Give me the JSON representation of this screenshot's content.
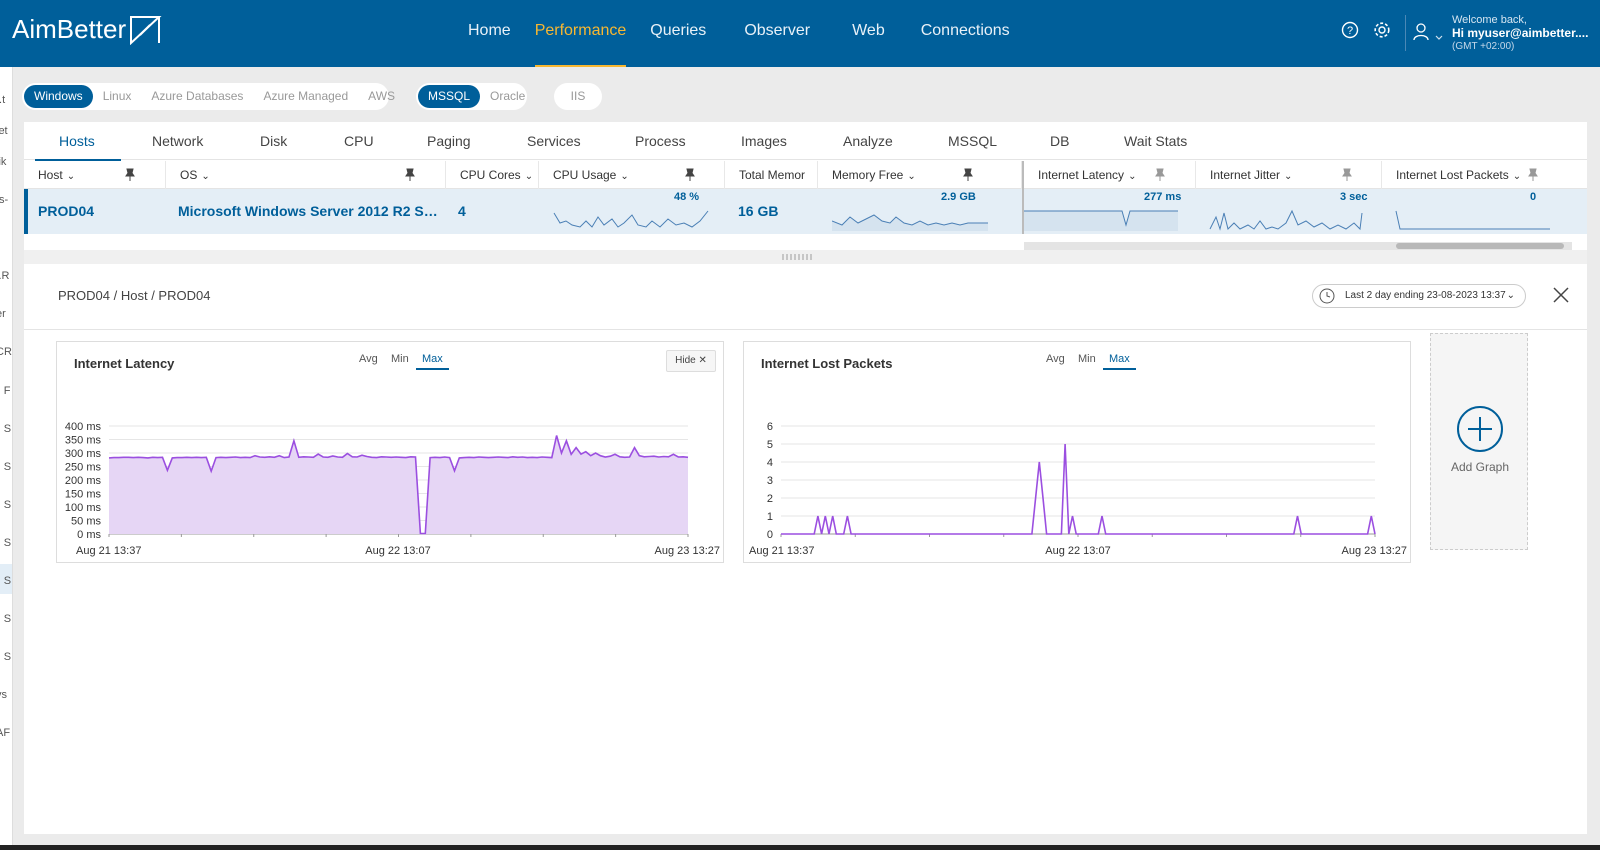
{
  "app": {
    "logo_text": "AimBetter",
    "brand_color": "#005f9a",
    "accent_color": "#f7b731"
  },
  "nav": {
    "items": [
      {
        "label": "Home"
      },
      {
        "label": "Performance",
        "active": true
      },
      {
        "label": "Queries"
      },
      {
        "label": "Observer"
      },
      {
        "label": "Web"
      },
      {
        "label": "Connections"
      }
    ]
  },
  "header": {
    "icons": [
      "help-icon",
      "settings-icon",
      "user-icon",
      "chevron-down-icon"
    ],
    "welcome": "Welcome back,",
    "user": "Hi myuser@aimbetter....",
    "timezone": "(GMT +02:00)"
  },
  "sidebar": {
    "fragments": [
      "ı.t",
      "let",
      "lik",
      "ıs-",
      "r",
      "l.R",
      "er",
      "CR",
      "▌F",
      "▌S",
      "▌S",
      "▌S",
      "▌S",
      "▌S",
      "▌S",
      "▌S",
      "ys",
      "AF"
    ]
  },
  "filters": {
    "platforms": [
      "Windows",
      "Linux",
      "Azure Databases",
      "Azure Managed",
      "AWS"
    ],
    "platform_selected": "Windows",
    "db_types": [
      "MSSQL",
      "Oracle"
    ],
    "db_selected": "MSSQL",
    "web": [
      "IIS"
    ]
  },
  "tabs": [
    "Hosts",
    "Network",
    "Disk",
    "CPU",
    "Paging",
    "Services",
    "Process",
    "Images",
    "Analyze",
    "MSSQL",
    "DB",
    "Wait Stats"
  ],
  "active_tab": "Hosts",
  "table": {
    "columns": [
      "Host",
      "OS",
      "CPU Cores",
      "CPU Usage",
      "Total Memor",
      "Memory Free",
      "Internet Latency",
      "Internet Jitter",
      "Internet Lost Packets"
    ],
    "row": {
      "host": "PROD04",
      "os": "Microsoft Windows Server 2012 R2 Standard",
      "cpu_cores": "4",
      "cpu_usage": "48 %",
      "total_memory": "16 GB",
      "memory_free": "2.9 GB",
      "internet_latency": "277 ms",
      "internet_jitter": "3 sec",
      "internet_lost_packets": "0"
    }
  },
  "detail": {
    "breadcrumb": "PROD04 / Host / PROD04",
    "time_range": "Last 2 day ending  23-08-2023 13:37",
    "add_graph_label": "Add Graph",
    "hide_label": "Hide",
    "aggregations": [
      "Avg",
      "Min",
      "Max"
    ],
    "aggregation_selected": "Max"
  },
  "chart_data": [
    {
      "type": "area",
      "title": "Internet Latency",
      "y_ticks": [
        "0 ms",
        "50 ms",
        "100 ms",
        "150 ms",
        "200 ms",
        "250 ms",
        "300 ms",
        "350 ms",
        "400 ms"
      ],
      "ylim": [
        0,
        400
      ],
      "x_labels": [
        "Aug 21 13:37",
        "Aug 22 13:07",
        "Aug 23 13:27"
      ],
      "grid": true,
      "color": "#9b4fe0",
      "fill": "#e6d6f5",
      "series": [
        {
          "values": [
            282,
            283,
            283,
            284,
            284,
            283,
            284,
            283,
            282,
            284,
            283,
            284,
            236,
            282,
            283,
            283,
            284,
            283,
            284,
            283,
            284,
            233,
            283,
            284,
            283,
            284,
            285,
            283,
            284,
            283,
            290,
            285,
            284,
            286,
            284,
            290,
            283,
            285,
            345,
            284,
            286,
            285,
            284,
            296,
            285,
            284,
            289,
            285,
            284,
            298,
            286,
            285,
            292,
            287,
            284,
            283,
            286,
            285,
            284,
            285,
            284,
            283,
            286,
            285,
            2,
            2,
            283,
            284,
            283,
            285,
            283,
            234,
            282,
            283,
            284,
            283,
            285,
            284,
            283,
            284,
            285,
            284,
            283,
            286,
            284,
            285,
            283,
            284,
            283,
            285,
            284,
            283,
            365,
            300,
            345,
            295,
            320,
            296,
            305,
            290,
            300,
            290,
            285,
            288,
            295,
            286,
            284,
            285,
            320,
            290,
            286,
            287,
            288,
            285,
            287,
            286,
            295,
            285,
            286,
            284
          ]
        }
      ]
    },
    {
      "type": "line",
      "title": "Internet Lost Packets",
      "y_ticks": [
        "0",
        "1",
        "2",
        "3",
        "4",
        "5",
        "6"
      ],
      "ylim": [
        0,
        6
      ],
      "x_labels": [
        "Aug 21 13:37",
        "Aug 22 13:07",
        "Aug 23 13:27"
      ],
      "grid": true,
      "color": "#9b4fe0",
      "series": [
        {
          "values": [
            0,
            0,
            0,
            0,
            0,
            0,
            0,
            0,
            0,
            0,
            1,
            0,
            1,
            0,
            1,
            0,
            0,
            0,
            1,
            0,
            0,
            0,
            0,
            0,
            0,
            0,
            0,
            0,
            0,
            0,
            0,
            0,
            0,
            0,
            0,
            0,
            0,
            0,
            0,
            0,
            0,
            0,
            0,
            0,
            0,
            0,
            0,
            0,
            0,
            0,
            0,
            0,
            0,
            0,
            0,
            0,
            0,
            0,
            0,
            0,
            0,
            0,
            0,
            0,
            0,
            0,
            0,
            0,
            0,
            2,
            4,
            2,
            0,
            0,
            0,
            0,
            0,
            5,
            0,
            1,
            0,
            0,
            0,
            0,
            0,
            0,
            0,
            1,
            0,
            0,
            0,
            0,
            0,
            0,
            0,
            0,
            0,
            0,
            0,
            0,
            0,
            0,
            0,
            0,
            0,
            0,
            0,
            0,
            0,
            0,
            0,
            0,
            0,
            0,
            0,
            0,
            0,
            0,
            0,
            0,
            0,
            0,
            0,
            0,
            0,
            0,
            0,
            0,
            0,
            0,
            0,
            0,
            0,
            0,
            0,
            0,
            0,
            0,
            0,
            0,
            1,
            0,
            0,
            0,
            0,
            0,
            0,
            0,
            0,
            0,
            0,
            0,
            0,
            0,
            0,
            0,
            0,
            0,
            0,
            0,
            1,
            0
          ]
        }
      ]
    }
  ]
}
